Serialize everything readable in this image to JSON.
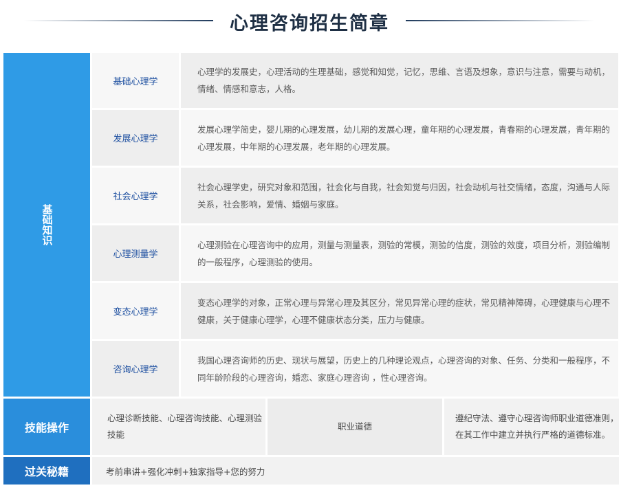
{
  "title": "心理咨询招生简章",
  "categories": {
    "basic": "基础知识",
    "skill": "技能操作",
    "tips": "过关秘籍"
  },
  "subjects": [
    {
      "name": "基础心理学",
      "desc": "心理学的发展史，心理活动的生理基础，感觉和知觉，记忆，思维、言语及想象，意识与注意，需要与动机，情绪、情感和意志，人格。"
    },
    {
      "name": "发展心理学",
      "desc": "发展心理学简史，婴儿期的心理发展，幼儿期的发展心理，童年期的心理发展，青春期的心理发展，青年期的心理发展，中年期的心理发展，老年期的心理发展。"
    },
    {
      "name": "社会心理学",
      "desc": "社会心理学史，研究对象和范围，社会化与自我，社会知觉与归因，社会动机与社交情绪，态度，沟通与人际关系，社会影响，爱情、婚姻与家庭。"
    },
    {
      "name": "心理测量学",
      "desc": "心理测验在心理咨询中的应用，测量与测量表，测验的常模，测验的信度，测验的效度，项目分析，测验编制的一般程序，心理测验的使用。"
    },
    {
      "name": "变态心理学",
      "desc": "变态心理学的对象，正常心理与异常心理及其区分，常见异常心理的症状，常见精神障碍，心理健康与心理不健康，关于健康心理学，心理不健康状态分类，压力与健康。"
    },
    {
      "name": "咨询心理学",
      "desc": "我国心理咨询师的历史、现状与展望，历史上的几种理论观点，心理咨询的对象、任务、分类和一般程序，不同年龄阶段的心理咨询，婚恋、家庭心理咨询 ，性心理咨询。"
    }
  ],
  "skills": {
    "col1": "心理诊断技能、心理咨询技能、心理测验技能",
    "col2": "职业道德",
    "col3": "遵纪守法、遵守心理咨询师职业道德准则，在其工作中建立并执行严格的道德标准。"
  },
  "tips_text": "考前串讲+强化冲刺+独家指导+您的努力"
}
